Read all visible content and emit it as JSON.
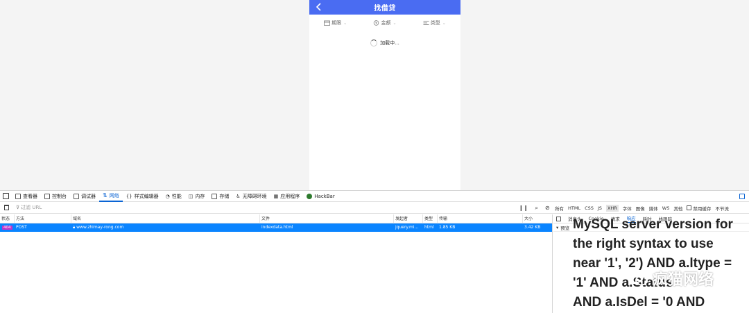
{
  "mobile_page": {
    "title": "找借贷",
    "header_color": "#4a6cf2",
    "filters": [
      {
        "label": "期限",
        "icon": "calendar-icon"
      },
      {
        "label": "金额",
        "icon": "yen-icon"
      },
      {
        "label": "类型",
        "icon": "list-icon"
      }
    ],
    "loading_text": "加载中..."
  },
  "devtools": {
    "tabs": [
      {
        "label": "查看器",
        "icon": "inspector-icon"
      },
      {
        "label": "控制台",
        "icon": "console-icon"
      },
      {
        "label": "调试器",
        "icon": "debugger-icon"
      },
      {
        "label": "网络",
        "icon": "network-icon",
        "active": true
      },
      {
        "label": "样式编辑器",
        "icon": "style-editor-icon"
      },
      {
        "label": "性能",
        "icon": "performance-icon"
      },
      {
        "label": "内存",
        "icon": "memory-icon"
      },
      {
        "label": "存储",
        "icon": "storage-icon"
      },
      {
        "label": "无障碍环境",
        "icon": "accessibility-icon"
      },
      {
        "label": "应用程序",
        "icon": "application-icon"
      },
      {
        "label": "HackBar",
        "icon": "hackbar-icon"
      }
    ],
    "filter_placeholder": "过滤 URL",
    "type_filters": [
      "所有",
      "HTML",
      "CSS",
      "JS",
      "XHR",
      "字体",
      "图像",
      "媒体",
      "WS",
      "其他"
    ],
    "active_type_filter": "XHR",
    "disable_cache_label": "禁用缓存",
    "throttle_label": "不节流",
    "columns": [
      "状态",
      "方法",
      "域名",
      "文件",
      "发起者",
      "类型",
      "传输",
      "大小"
    ],
    "request": {
      "status": "404",
      "method": "POST",
      "domain": "www.zhimay-rong.com",
      "file": "indexdata.html",
      "initiator": "jquery.mi...",
      "type": "html",
      "transferred": "1.85 KB",
      "size": "3.42 KB"
    },
    "detail_tabs": [
      "消息头",
      "Cookie",
      "请求",
      "响应",
      "耗时",
      "栈跟踪"
    ],
    "active_detail_tab": "响应",
    "preview_label": "预览",
    "response_lines": [
      "MySQL server version for",
      "the right syntax to use",
      "near '1', '2') AND a.ltype =",
      "'1' AND a.Status",
      "AND a.IsDel = '0  AND"
    ]
  },
  "watermark_text": "疯猫网络",
  "accent_color": "#0a84ff",
  "status_color": "#c535c8"
}
